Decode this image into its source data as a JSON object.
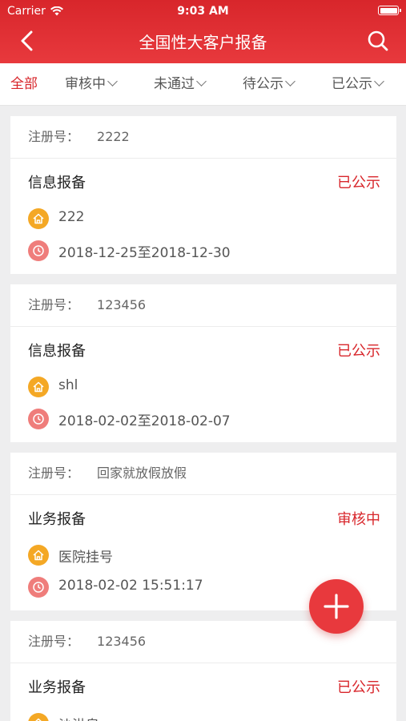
{
  "status_bar": {
    "carrier": "Carrier",
    "time": "9:03 AM"
  },
  "nav": {
    "title": "全国性大客户报备"
  },
  "tabs": [
    {
      "label": "全部",
      "active": true,
      "has_dropdown": false
    },
    {
      "label": "审核中",
      "active": false,
      "has_dropdown": true
    },
    {
      "label": "未通过",
      "active": false,
      "has_dropdown": true
    },
    {
      "label": "待公示",
      "active": false,
      "has_dropdown": true
    },
    {
      "label": "已公示",
      "active": false,
      "has_dropdown": true
    }
  ],
  "cards": [
    {
      "reg_label": "注册号：",
      "reg_no": "2222",
      "type": "信息报备",
      "status": "已公示",
      "name": "222",
      "time": "2018-12-25至2018-12-30"
    },
    {
      "reg_label": "注册号：",
      "reg_no": "123456",
      "type": "信息报备",
      "status": "已公示",
      "name": "shl",
      "time": "2018-02-02至2018-02-07"
    },
    {
      "reg_label": "注册号：",
      "reg_no": "回家就放假放假",
      "type": "业务报备",
      "status": "审核中",
      "name": "医院挂号",
      "time": "2018-02-02 15:51:17"
    },
    {
      "reg_label": "注册号：",
      "reg_no": "123456",
      "type": "业务报备",
      "status": "已公示",
      "name": "沙洪泉",
      "time": ""
    }
  ],
  "colors": {
    "accent": "#d8262b",
    "house_icon": "#f4a825",
    "clock_icon": "#ef7d7b"
  },
  "icons": {
    "back": "chevron-left-icon",
    "search": "search-icon",
    "add": "plus-icon"
  }
}
